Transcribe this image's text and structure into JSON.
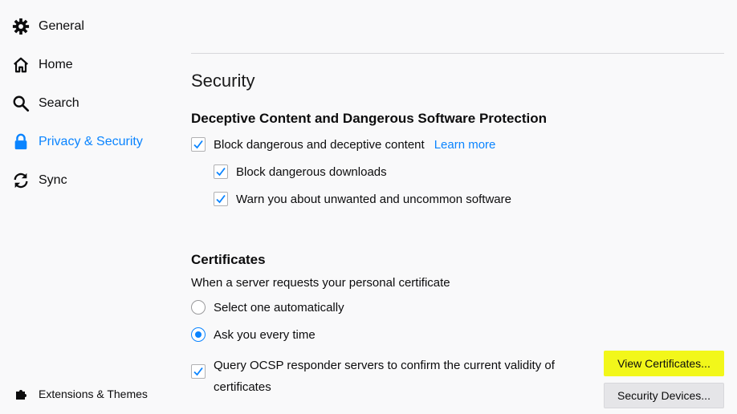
{
  "sidebar": {
    "items": [
      {
        "label": "General",
        "icon": "gear-icon"
      },
      {
        "label": "Home",
        "icon": "home-icon"
      },
      {
        "label": "Search",
        "icon": "search-icon"
      },
      {
        "label": "Privacy & Security",
        "icon": "lock-icon"
      },
      {
        "label": "Sync",
        "icon": "sync-icon"
      }
    ],
    "active_index": 3,
    "extensions_label": "Extensions & Themes"
  },
  "main": {
    "section_title": "Security",
    "deceptive": {
      "heading": "Deceptive Content and Dangerous Software Protection",
      "block_label": "Block dangerous and deceptive content",
      "block_checked": true,
      "learn_more": "Learn more",
      "downloads_label": "Block dangerous downloads",
      "downloads_checked": true,
      "unwanted_label": "Warn you about unwanted and uncommon software",
      "unwanted_checked": true
    },
    "certificates": {
      "heading": "Certificates",
      "prompt": "When a server requests your personal certificate",
      "radio_auto": "Select one automatically",
      "radio_ask": "Ask you every time",
      "selected": "ask",
      "ocsp_line1": "Query OCSP responder servers to confirm the current validity of",
      "ocsp_line2": "certificates",
      "ocsp_checked": true,
      "view_button": "View Certificates...",
      "devices_button": "Security Devices..."
    }
  },
  "colors": {
    "accent": "#0a84ff",
    "highlight": "#f2f71a",
    "background": "#f9f9fa"
  }
}
